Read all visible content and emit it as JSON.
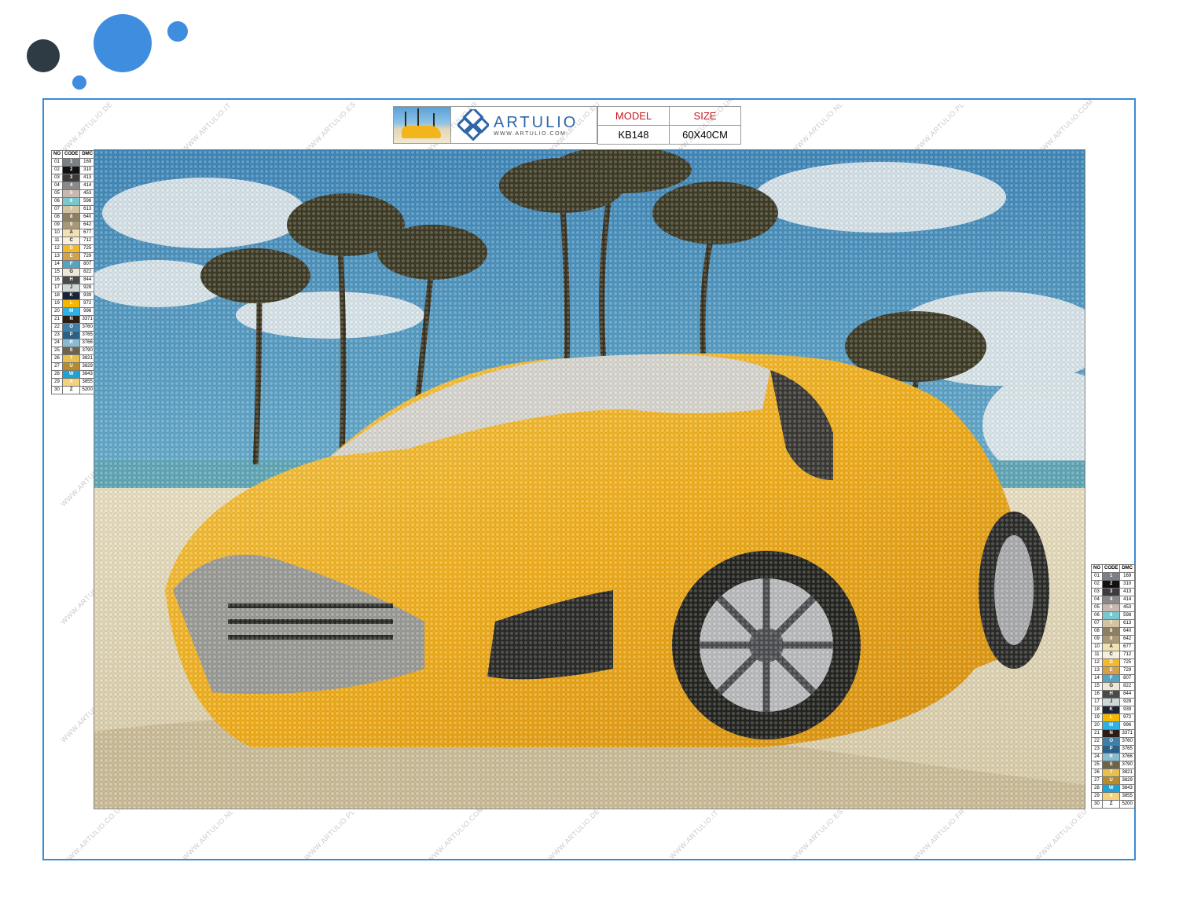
{
  "header": {
    "brand": "ARTULIO",
    "url": "WWW.ARTULIO.COM",
    "model_label": "MODEL",
    "size_label": "SIZE",
    "model_value": "KB148",
    "size_value": "60X40CM"
  },
  "watermarks": [
    "WWW.ARTULIO.DE",
    "WWW.ARTULIO.IT",
    "WWW.ARTULIO.ES",
    "WWW.ARTULIO.FR",
    "WWW.ARTULIO.EU",
    "WWW.ARTULIO.CO.UK",
    "WWW.ARTULIO.NL",
    "WWW.ARTULIO.PL",
    "WWW.ARTULIO.COM"
  ],
  "legend": {
    "headers": [
      "NO",
      "CODE",
      "DMC"
    ],
    "rows": [
      {
        "no": "01",
        "code": "1",
        "dmc": "169",
        "color": "#7c7f86"
      },
      {
        "no": "02",
        "code": "2",
        "dmc": "310",
        "color": "#111111"
      },
      {
        "no": "03",
        "code": "3",
        "dmc": "413",
        "color": "#3c3c3c"
      },
      {
        "no": "04",
        "code": "4",
        "dmc": "414",
        "color": "#8a8a8a"
      },
      {
        "no": "05",
        "code": "5",
        "dmc": "453",
        "color": "#c8b8b0"
      },
      {
        "no": "06",
        "code": "6",
        "dmc": "598",
        "color": "#79c7cf"
      },
      {
        "no": "07",
        "code": "7",
        "dmc": "613",
        "color": "#d3c3a3"
      },
      {
        "no": "08",
        "code": "8",
        "dmc": "640",
        "color": "#8d7f63"
      },
      {
        "no": "09",
        "code": "9",
        "dmc": "642",
        "color": "#a89878"
      },
      {
        "no": "10",
        "code": "A",
        "dmc": "677",
        "color": "#f0e2b4"
      },
      {
        "no": "11",
        "code": "C",
        "dmc": "712",
        "color": "#f6efdc"
      },
      {
        "no": "12",
        "code": "D",
        "dmc": "725",
        "color": "#f4b92b"
      },
      {
        "no": "13",
        "code": "E",
        "dmc": "729",
        "color": "#d4a04a"
      },
      {
        "no": "14",
        "code": "F",
        "dmc": "807",
        "color": "#55a5c0"
      },
      {
        "no": "15",
        "code": "G",
        "dmc": "822",
        "color": "#eee7d7"
      },
      {
        "no": "16",
        "code": "H",
        "dmc": "844",
        "color": "#4a4a48"
      },
      {
        "no": "17",
        "code": "J",
        "dmc": "928",
        "color": "#d0d8d6"
      },
      {
        "no": "18",
        "code": "K",
        "dmc": "939",
        "color": "#1b2338"
      },
      {
        "no": "19",
        "code": "L",
        "dmc": "972",
        "color": "#f7b600"
      },
      {
        "no": "20",
        "code": "M",
        "dmc": "996",
        "color": "#2fb0e6"
      },
      {
        "no": "21",
        "code": "N",
        "dmc": "3371",
        "color": "#2e1d14"
      },
      {
        "no": "22",
        "code": "O",
        "dmc": "3760",
        "color": "#3f7fa6"
      },
      {
        "no": "23",
        "code": "P",
        "dmc": "3765",
        "color": "#2c5f88"
      },
      {
        "no": "24",
        "code": "R",
        "dmc": "3766",
        "color": "#88bcd0"
      },
      {
        "no": "25",
        "code": "S",
        "dmc": "3790",
        "color": "#6e624a"
      },
      {
        "no": "26",
        "code": "T",
        "dmc": "3821",
        "color": "#e8c04c"
      },
      {
        "no": "27",
        "code": "U",
        "dmc": "3829",
        "color": "#b78a2a"
      },
      {
        "no": "28",
        "code": "W",
        "dmc": "3843",
        "color": "#1aa4d8"
      },
      {
        "no": "29",
        "code": "X",
        "dmc": "3855",
        "color": "#f4d27a"
      },
      {
        "no": "30",
        "code": "Z",
        "dmc": "5200",
        "color": "#ffffff"
      }
    ]
  }
}
